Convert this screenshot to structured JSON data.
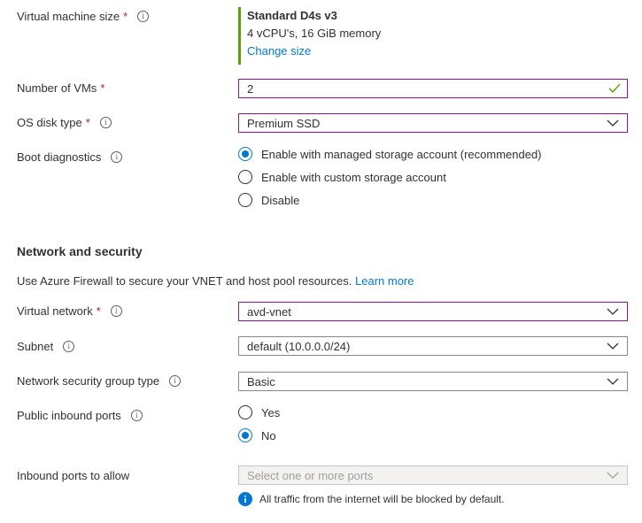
{
  "vm_size": {
    "label": "Virtual machine size",
    "required_mark": "*",
    "name": "Standard D4s v3",
    "specs": "4 vCPU's, 16 GiB memory",
    "change_link": "Change size"
  },
  "num_vms": {
    "label": "Number of VMs",
    "required_mark": "*",
    "value": "2"
  },
  "os_disk": {
    "label": "OS disk type",
    "required_mark": "*",
    "value": "Premium SSD"
  },
  "boot_diag": {
    "label": "Boot diagnostics",
    "options": [
      "Enable with managed storage account (recommended)",
      "Enable with custom storage account",
      "Disable"
    ],
    "selected_index": 0
  },
  "network": {
    "title": "Network and security",
    "firewall_text": "Use Azure Firewall to secure your VNET and host pool resources.",
    "learn_more": "Learn more",
    "vnet_label": "Virtual network",
    "vnet_required_mark": "*",
    "vnet_value": "avd-vnet",
    "subnet_label": "Subnet",
    "subnet_value": "default (10.0.0.0/24)",
    "nsg_label": "Network security group type",
    "nsg_value": "Basic",
    "public_ports_label": "Public inbound ports",
    "public_ports_options": [
      "Yes",
      "No"
    ],
    "public_ports_selected_index": 1,
    "inbound_label": "Inbound ports to allow",
    "inbound_placeholder": "Select one or more ports",
    "inbound_info": "All traffic from the internet will be blocked by default."
  },
  "colors": {
    "accent": "#0078d4",
    "required": "#a4262c",
    "focus_border": "#881798",
    "valid_green": "#57a300"
  },
  "icons": [
    "info-icon",
    "chevron-down-icon",
    "checkmark-icon",
    "info-filled-icon"
  ]
}
